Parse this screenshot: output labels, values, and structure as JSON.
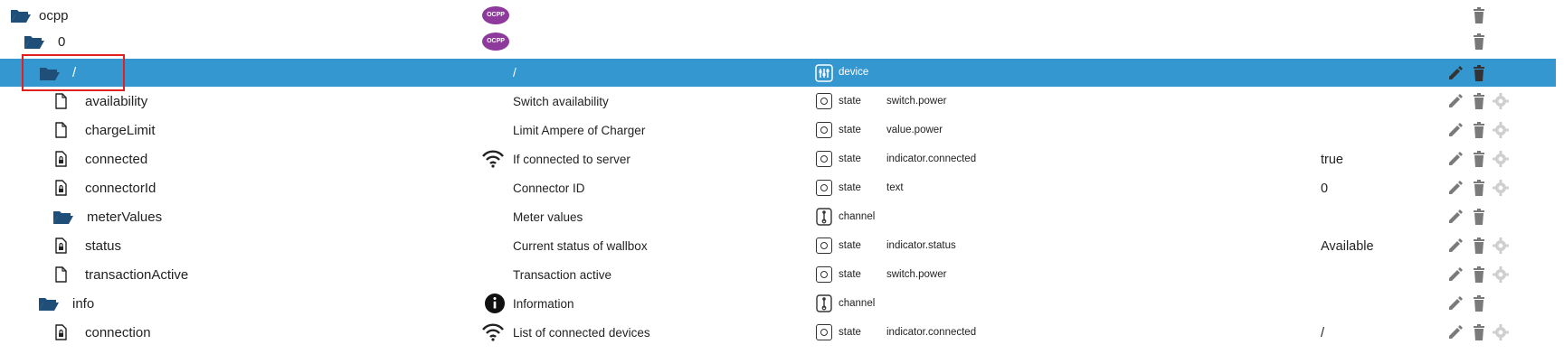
{
  "rows": [
    {
      "name": "ocpp",
      "icon": "folder-open-icon",
      "column_icon": "ocpp-logo",
      "ocpp_logo_text": "OCPP",
      "description": "",
      "type": "",
      "role": "",
      "value": "",
      "actions": [
        "trash"
      ]
    },
    {
      "name": "0",
      "icon": "folder-open-icon",
      "column_icon": "ocpp-logo",
      "ocpp_logo_text": "OCPP",
      "description": "",
      "type": "",
      "role": "",
      "value": "",
      "actions": [
        "trash"
      ]
    },
    {
      "name": "/",
      "icon": "folder-open-icon",
      "description": "/",
      "type": "device",
      "role": "",
      "value": "",
      "selected": true,
      "actions": [
        "edit",
        "trash"
      ]
    },
    {
      "name": "availability",
      "icon": "file-icon",
      "description": "Switch availability",
      "type": "state",
      "role": "switch.power",
      "value": "",
      "actions": [
        "edit",
        "trash",
        "gear"
      ]
    },
    {
      "name": "chargeLimit",
      "icon": "file-icon",
      "description": "Limit Ampere of Charger",
      "type": "state",
      "role": "value.power",
      "value": "",
      "actions": [
        "edit",
        "trash",
        "gear"
      ]
    },
    {
      "name": "connected",
      "icon": "lock-file-icon",
      "column_icon": "wifi-icon",
      "description": "If connected to server",
      "type": "state",
      "role": "indicator.connected",
      "value": "true",
      "actions": [
        "edit",
        "trash",
        "gear"
      ]
    },
    {
      "name": "connectorId",
      "icon": "lock-file-icon",
      "description": "Connector ID",
      "type": "state",
      "role": "text",
      "value": "0",
      "actions": [
        "edit",
        "trash",
        "gear"
      ]
    },
    {
      "name": "meterValues",
      "icon": "folder-open-icon",
      "description": "Meter values",
      "type": "channel",
      "role": "",
      "value": "",
      "actions": [
        "edit",
        "trash"
      ]
    },
    {
      "name": "status",
      "icon": "lock-file-icon",
      "description": "Current status of wallbox",
      "type": "state",
      "role": "indicator.status",
      "value": "Available",
      "actions": [
        "edit",
        "trash",
        "gear"
      ]
    },
    {
      "name": "transactionActive",
      "icon": "file-icon",
      "description": "Transaction active",
      "type": "state",
      "role": "switch.power",
      "value": "",
      "actions": [
        "edit",
        "trash",
        "gear"
      ]
    },
    {
      "name": "info",
      "icon": "folder-open-icon",
      "column_icon": "info-icon",
      "description": "Information",
      "type": "channel",
      "role": "",
      "value": "",
      "actions": [
        "edit",
        "trash"
      ]
    },
    {
      "name": "connection",
      "icon": "lock-file-icon",
      "column_icon": "wifi-icon",
      "description": "List of connected devices",
      "type": "state",
      "role": "indicator.connected",
      "value": "/",
      "actions": [
        "edit",
        "trash",
        "gear"
      ]
    }
  ],
  "colors": {
    "selected_row": "#3497cf",
    "folder": "#1f4e79",
    "highlight": "#e02020",
    "action_icon": "#7a7a7a"
  }
}
